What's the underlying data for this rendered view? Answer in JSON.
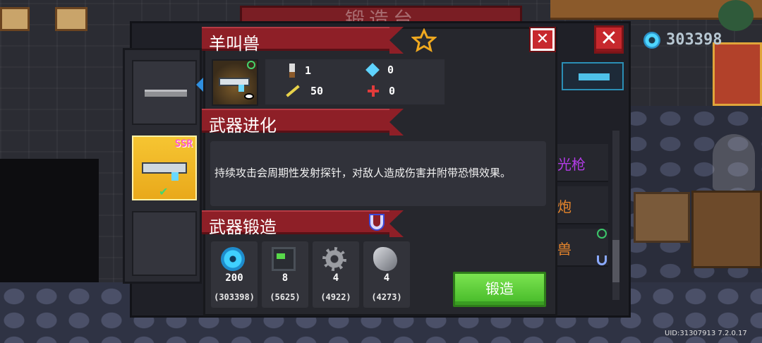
{
  "screen": {
    "title": "锻造台",
    "currency": {
      "value": "303398",
      "icon": "blue-gem-icon"
    },
    "uid": "UID:31307913 7.2.0.17"
  },
  "background_list": {
    "rows": [
      "光枪",
      "炮",
      "兽"
    ]
  },
  "weapon_list": {
    "selected_rarity": "SSR"
  },
  "detail": {
    "name": "羊叫兽",
    "stats": {
      "attack": "1",
      "energy": "0",
      "crit": "50",
      "precision": "0"
    },
    "evolution_title": "武器进化",
    "evolution_desc": "持续攻击会周期性发射探针，对敌人造成伤害并附带恐惧效果。",
    "forge_title": "武器锻造",
    "materials": [
      {
        "icon": "blue-gem-icon",
        "need": "200",
        "own": "(303398)"
      },
      {
        "icon": "weapon-part-icon",
        "need": "8",
        "own": "(5625)"
      },
      {
        "icon": "gear-icon",
        "need": "4",
        "own": "(4922)"
      },
      {
        "icon": "ore-icon",
        "need": "4",
        "own": "(4273)"
      }
    ],
    "forge_button": "锻造"
  },
  "colors": {
    "ribbon": "#8e1f27",
    "forge_button": "#5cc93a",
    "close": "#c7282d",
    "ssr_card": "#f6c532"
  }
}
